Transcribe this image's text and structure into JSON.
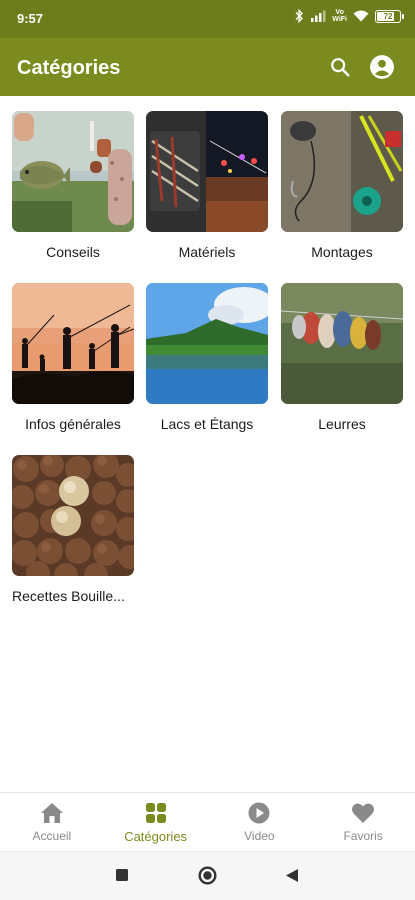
{
  "status": {
    "time": "9:57",
    "vowifi_top": "Vo",
    "vowifi_bottom": "WiFi",
    "battery": "72",
    "battery_fraction": 0.72
  },
  "appbar": {
    "title": "Catégories"
  },
  "categories": [
    {
      "label": "Conseils",
      "image": "fishing-advice-photo"
    },
    {
      "label": "Matériels",
      "image": "fishing-gear-photo"
    },
    {
      "label": "Montages",
      "image": "fishing-rigs-photo"
    },
    {
      "label": "Infos générales",
      "image": "anglers-sunset-photo"
    },
    {
      "label": "Lacs et Étangs",
      "image": "lake-photo"
    },
    {
      "label": "Leurres",
      "image": "lures-photo"
    },
    {
      "label": "Recettes Bouille...",
      "image": "boilies-photo"
    }
  ],
  "nav": {
    "items": [
      {
        "label": "Accueil",
        "icon": "home-icon"
      },
      {
        "label": "Catégories",
        "icon": "grid-icon"
      },
      {
        "label": "Video",
        "icon": "play-icon"
      },
      {
        "label": "Favoris",
        "icon": "heart-icon"
      }
    ],
    "active": "Catégories"
  },
  "colors": {
    "primary": "#7b8b1f",
    "statusbar": "#6e7d1b",
    "inactive": "#8a8a8a"
  }
}
